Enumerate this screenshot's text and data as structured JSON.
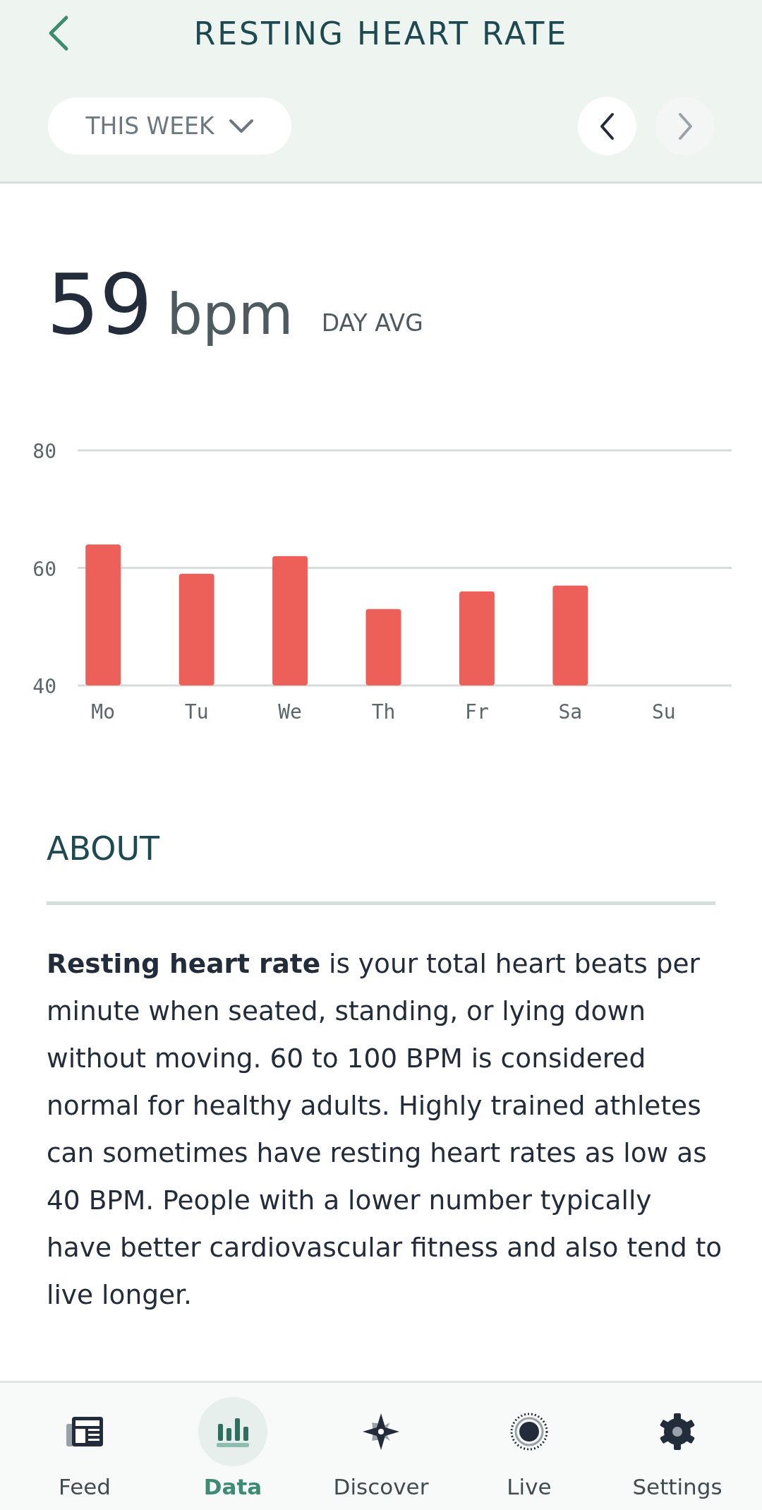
{
  "header": {
    "title": "RESTING HEART RATE",
    "period": "THIS WEEK",
    "prev_enabled": true,
    "next_enabled": false
  },
  "summary": {
    "value": "59",
    "unit": "bpm",
    "label": "DAY AVG"
  },
  "chart_data": {
    "type": "bar",
    "categories": [
      "Mo",
      "Tu",
      "We",
      "Th",
      "Fr",
      "Sa",
      "Su"
    ],
    "series": [
      {
        "color": "#ec6059",
        "values": [
          64,
          59,
          62,
          53,
          56,
          57,
          null
        ]
      }
    ],
    "ylim": [
      40,
      80
    ],
    "yticks": [
      40,
      60,
      80
    ]
  },
  "about": {
    "title": "ABOUT",
    "text": "**Resting heart rate** is your total heart beats per minute when seated, standing, or lying down without moving. 60 to 100 BPM is considered normal for healthy adults. Highly trained athletes can sometimes have resting heart rates as low as 40 BPM. People with a lower number typically have better cardiovascular fitness and also tend to live longer."
  },
  "nav": [
    {
      "kind": "feed",
      "label": "Feed",
      "selected": false
    },
    {
      "kind": "data",
      "label": "Data",
      "selected": true
    },
    {
      "kind": "discover",
      "label": "Discover",
      "selected": false
    },
    {
      "kind": "live",
      "label": "Live",
      "selected": false
    },
    {
      "kind": "settings",
      "label": "Settings",
      "selected": false
    }
  ]
}
